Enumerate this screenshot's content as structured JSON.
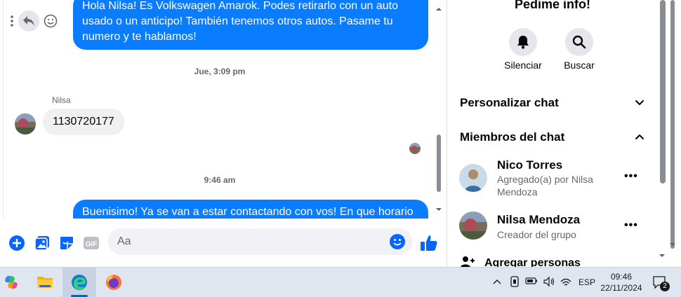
{
  "chat": {
    "messages": [
      {
        "type": "outgoing",
        "text": "Hola Nilsa! Es Volkswagen Amarok. Podes retirarlo con un auto usado o un anticipo! También tenemos otros autos. Pasame tu numero y te hablamos!"
      },
      {
        "type": "timestamp",
        "text": "Jue, 3:09 pm"
      },
      {
        "type": "sender",
        "text": "Nilsa"
      },
      {
        "type": "incoming",
        "text": "1130720177"
      },
      {
        "type": "timestamp",
        "text": "9:46 am"
      },
      {
        "type": "outgoing",
        "text": "Buenisimo! Ya se van a estar contactando con vos! En que horario"
      }
    ],
    "composer": {
      "placeholder": "Aa"
    }
  },
  "side": {
    "title": "Pedime info!",
    "actions": [
      {
        "label": "Silenciar",
        "icon": "bell-icon"
      },
      {
        "label": "Buscar",
        "icon": "search-icon"
      }
    ],
    "sections": {
      "customize": "Personalizar chat",
      "members": "Miembros del chat"
    },
    "members": [
      {
        "name": "Nico Torres",
        "sub": "Agregado(a) por Nilsa Mendoza"
      },
      {
        "name": "Nilsa Mendoza",
        "sub": "Creador del grupo"
      }
    ],
    "add_people": "Agregar personas",
    "more": "•••"
  },
  "taskbar": {
    "lang": "ESP",
    "time": "09:46",
    "date": "22/11/2024",
    "notifications": "2"
  },
  "colors": {
    "accent": "#0a7cff",
    "icon_blue": "#0866ff"
  }
}
